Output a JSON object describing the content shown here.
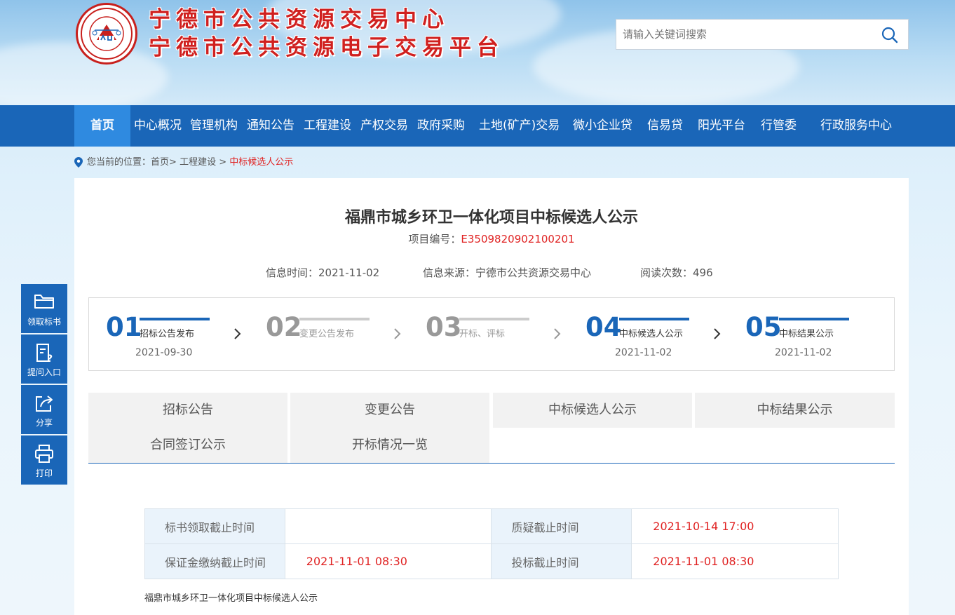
{
  "header": {
    "title_line1": "宁德市公共资源交易中心",
    "title_line2": "宁德市公共资源电子交易平台",
    "logo_text": "宁德市公共资源交易中心 公开 公平 公正",
    "search_placeholder": "请输入关键词搜索"
  },
  "nav": {
    "items": [
      {
        "label": "首页",
        "active": true
      },
      {
        "label": "中心概况"
      },
      {
        "label": "管理机构"
      },
      {
        "label": "通知公告"
      },
      {
        "label": "工程建设"
      },
      {
        "label": "产权交易"
      },
      {
        "label": "政府采购"
      },
      {
        "label": "土地(矿产)交易"
      },
      {
        "label": "微小企业贷"
      },
      {
        "label": "信易贷"
      },
      {
        "label": "阳光平台"
      },
      {
        "label": "行管委"
      },
      {
        "label": "行政服务中心"
      }
    ]
  },
  "breadcrumb": {
    "prefix": "您当前的位置：",
    "home": "首页",
    "sep1": ">",
    "level1": "工程建设",
    "sep2": ">",
    "current": "中标候选人公示"
  },
  "article": {
    "title": "福鼎市城乡环卫一体化项目中标候选人公示",
    "project_no_label": "项目编号：",
    "project_no": "E3509820902100201",
    "info_time_label": "信息时间：",
    "info_time": "2021-11-02",
    "info_source_label": "信息来源：",
    "info_source": "宁德市公共资源交易中心",
    "read_count_label": "阅读次数：",
    "read_count": "496"
  },
  "steps": [
    {
      "num": "01",
      "label": "招标公告发布",
      "date": "2021-09-30",
      "active": true
    },
    {
      "num": "02",
      "label": "变更公告发布",
      "date": "",
      "active": false
    },
    {
      "num": "03",
      "label": "开标、评标",
      "date": "",
      "active": false
    },
    {
      "num": "04",
      "label": "中标候选人公示",
      "date": "2021-11-02",
      "active": true
    },
    {
      "num": "05",
      "label": "中标结果公示",
      "date": "2021-11-02",
      "active": true
    }
  ],
  "tabs": [
    {
      "label": "招标公告"
    },
    {
      "label": "变更公告"
    },
    {
      "label": "中标候选人公示",
      "active": true
    },
    {
      "label": "中标结果公示"
    },
    {
      "label": "合同签订公示"
    },
    {
      "label": "开标情况一览"
    }
  ],
  "info_table": {
    "row1": {
      "k1": "标书领取截止时间",
      "v1": "",
      "k2": "质疑截止时间",
      "v2": "2021-10-14 17:00"
    },
    "row2": {
      "k1": "保证金缴纳截止时间",
      "v1": "2021-11-01 08:30",
      "k2": "投标截止时间",
      "v2": "2021-11-01 08:30"
    }
  },
  "body_text": "福鼎市城乡环卫一体化项目中标候选人公示",
  "sidebar": {
    "items": [
      {
        "label": "领取标书",
        "icon": "folder-icon"
      },
      {
        "label": "提问入口",
        "icon": "question-doc-icon"
      },
      {
        "label": "分享",
        "icon": "share-icon"
      },
      {
        "label": "打印",
        "icon": "printer-icon"
      }
    ]
  },
  "colors": {
    "primary": "#1a66b8",
    "nav_active": "#2f8ae0",
    "accent_red": "#e02323",
    "title_red": "#d0201f"
  }
}
